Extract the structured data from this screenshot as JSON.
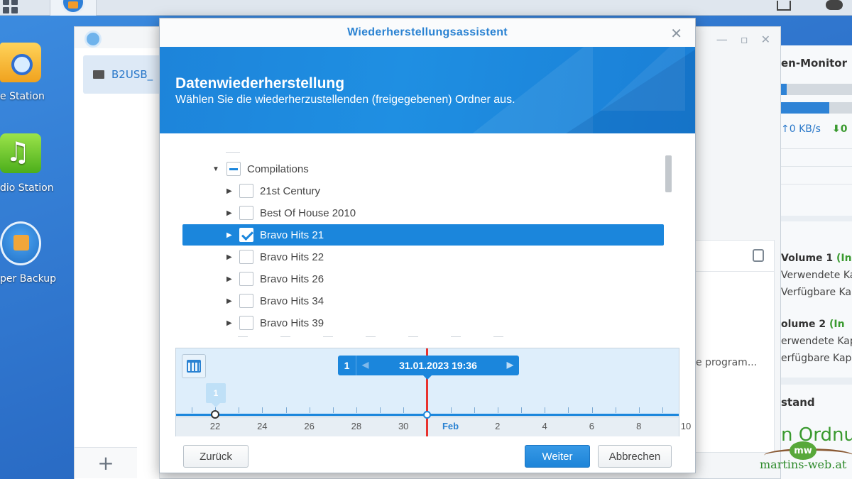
{
  "desktop": {
    "icons": [
      {
        "label": "e Station",
        "icon": "search-folder-icon"
      },
      {
        "label": "dio Station",
        "icon": "music-note-icon"
      },
      {
        "label": "per Backup",
        "icon": "backup-icon"
      }
    ]
  },
  "background_window": {
    "item_label": "B2USB_",
    "panel_text": "e program...",
    "add_label": "+"
  },
  "widgets": {
    "resource_monitor_title": "en-Monitor",
    "upload_speed": "↑0 KB/s",
    "download_speed": "⬇0",
    "volume1_title": "Volume 1",
    "volume1_status": "(In",
    "volume1_used": "Verwendete Kap",
    "volume1_free": "Verfügbare Kap",
    "volume2_title": "olume 2",
    "volume2_status": "(In",
    "volume2_used": "erwendete Kap",
    "volume2_free": "erfügbare Kap",
    "health_title": "stand",
    "health_status": "n Ordnun"
  },
  "watermark": {
    "logo": "mw",
    "text": "martins-web.at"
  },
  "modal": {
    "title": "Wiederherstellungsassistent",
    "banner_title": "Datenwiederherstellung",
    "banner_subtitle": "Wählen Sie die wiederherzustellenden (freigegebenen) Ordner aus.",
    "tree": [
      {
        "label": "Compilations",
        "expanded": true,
        "state": "partial",
        "level": 0
      },
      {
        "label": "21st Century",
        "state": "unchecked",
        "level": 1
      },
      {
        "label": "Best Of House 2010",
        "state": "unchecked",
        "level": 1
      },
      {
        "label": "Bravo Hits 21",
        "state": "checked",
        "level": 1,
        "selected": true
      },
      {
        "label": "Bravo Hits 22",
        "state": "unchecked",
        "level": 1
      },
      {
        "label": "Bravo Hits 26",
        "state": "unchecked",
        "level": 1
      },
      {
        "label": "Bravo Hits 34",
        "state": "unchecked",
        "level": 1
      },
      {
        "label": "Bravo Hits 39",
        "state": "unchecked",
        "level": 1
      }
    ],
    "timeline": {
      "count": "1",
      "current": "31.01.2023 19:36",
      "bubble": "1",
      "ticks": [
        "22",
        "24",
        "26",
        "28",
        "30",
        "Feb",
        "2",
        "4",
        "6",
        "8",
        "10"
      ],
      "month_tick": "Feb"
    },
    "buttons": {
      "back": "Zurück",
      "next": "Weiter",
      "cancel": "Abbrechen"
    },
    "accent_color": "#1b86dc"
  }
}
